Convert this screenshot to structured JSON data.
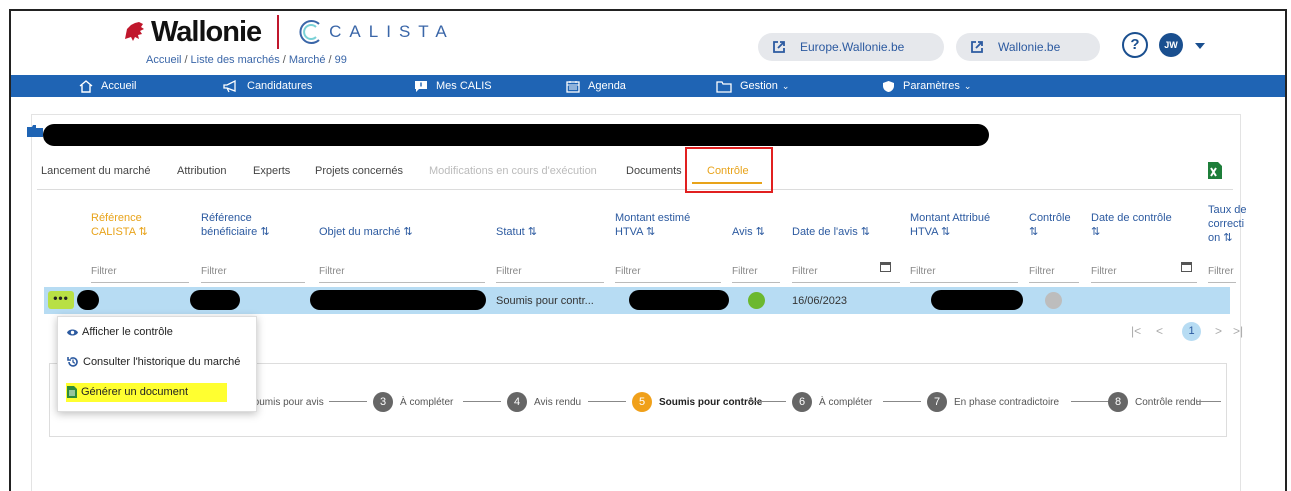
{
  "header": {
    "brand": "Wallonie",
    "app_name": "CALISTA",
    "breadcrumb": [
      "Accueil",
      "Liste des marchés",
      "Marché",
      "99"
    ],
    "links": [
      "Europe.Wallonie.be",
      "Wallonie.be"
    ],
    "help_label": "?",
    "avatar_initials": "JW"
  },
  "nav": {
    "items": [
      {
        "label": "Accueil",
        "icon": "home-icon"
      },
      {
        "label": "Candidatures",
        "icon": "megaphone-icon"
      },
      {
        "label": "Mes CALIS",
        "icon": "alert-message-icon"
      },
      {
        "label": "Agenda",
        "icon": "calendar-icon"
      },
      {
        "label": "Gestion",
        "icon": "folder-icon",
        "has_dropdown": true
      },
      {
        "label": "Paramètres",
        "icon": "shield-icon",
        "has_dropdown": true
      }
    ]
  },
  "tabs": {
    "items": [
      "Lancement du marché",
      "Attribution",
      "Experts",
      "Projets concernés",
      "Modifications en cours d'exécution",
      "Documents",
      "Contrôle"
    ],
    "active": "Contrôle",
    "disabled": [
      "Modifications en cours d'exécution"
    ]
  },
  "table": {
    "headers": {
      "ref_calista_1": "Référence",
      "ref_calista_2": "CALISTA ⇅",
      "ref_benef_1": "Référence",
      "ref_benef_2": "bénéficiaire ⇅",
      "objet": "Objet du marché ⇅",
      "statut": "Statut ⇅",
      "montant_1": "Montant estimé",
      "montant_2": "HTVA ⇅",
      "avis": "Avis ⇅",
      "date_avis": "Date de l'avis ⇅",
      "attribue_1": "Montant Attribué",
      "attribue_2": "HTVA ⇅",
      "controle_1": "Contrôle",
      "controle_2": "⇅",
      "date_controle_1": "Date de contrôle",
      "date_controle_2": "⇅",
      "taux_1": "Taux de",
      "taux_2": "correcti",
      "taux_3": "on ⇅"
    },
    "filter_placeholder": "Filtrer",
    "row": {
      "actions_label": "•••",
      "statut": "Soumis pour contr...",
      "date_avis": "16/06/2023",
      "avis_color": "#6cb82e",
      "controle_color": "#bdbdbd"
    }
  },
  "pagination": {
    "first": "|<",
    "prev": "<",
    "current": "1",
    "next": ">",
    "last": ">|"
  },
  "context_menu": {
    "items": [
      "Afficher le contrôle",
      "Consulter l'historique du marché",
      "Générer un document"
    ]
  },
  "stepper": {
    "steps": [
      {
        "num": "3",
        "label": "À compléter"
      },
      {
        "num": "4",
        "label": "Avis rendu"
      },
      {
        "num": "5",
        "label": "Soumis pour contrôle"
      },
      {
        "num": "6",
        "label": "À compléter"
      },
      {
        "num": "7",
        "label": "En phase contradictoire"
      },
      {
        "num": "8",
        "label": "Contrôle rendu"
      }
    ],
    "step2_label": "Soumis pour avis",
    "current": "5"
  },
  "colors": {
    "nav_blue": "#1f64b4",
    "accent_orange": "#e8a31a",
    "row_highlight": "#b7dcf3",
    "brand_red": "#c0172c"
  }
}
